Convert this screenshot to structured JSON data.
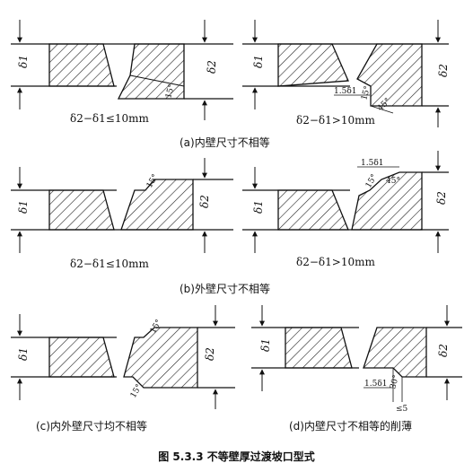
{
  "figure_title": "图 5.3.3   不等壁厚过渡坡口型式",
  "panels": {
    "a": {
      "caption": "(a)内壁尺寸不相等",
      "cond_left": "δ2−δ1≤10mm",
      "cond_right": "δ2−δ1>10mm",
      "angle_left": "15°",
      "angle_right": "15°",
      "angle_bevel": "45°",
      "len_label": "1.5δ1"
    },
    "b": {
      "caption": "(b)外壁尺寸不相等",
      "cond_left": "δ2−δ1≤10mm",
      "cond_right": "δ2−δ1>10mm",
      "angle_left": "15°",
      "angle_right": "15°",
      "angle_bevel": "45°",
      "len_label": "1.5δ1"
    },
    "c": {
      "caption": "(c)内外壁尺寸均不相等",
      "angle_top": "15°",
      "angle_bottom": "15°"
    },
    "d": {
      "caption": "(d)内壁尺寸不相等的削薄",
      "len_label": "1.5δ1",
      "angle": "30°",
      "max_label": "≤5"
    }
  },
  "labels": {
    "delta1": "δ1",
    "delta2": "δ2"
  }
}
